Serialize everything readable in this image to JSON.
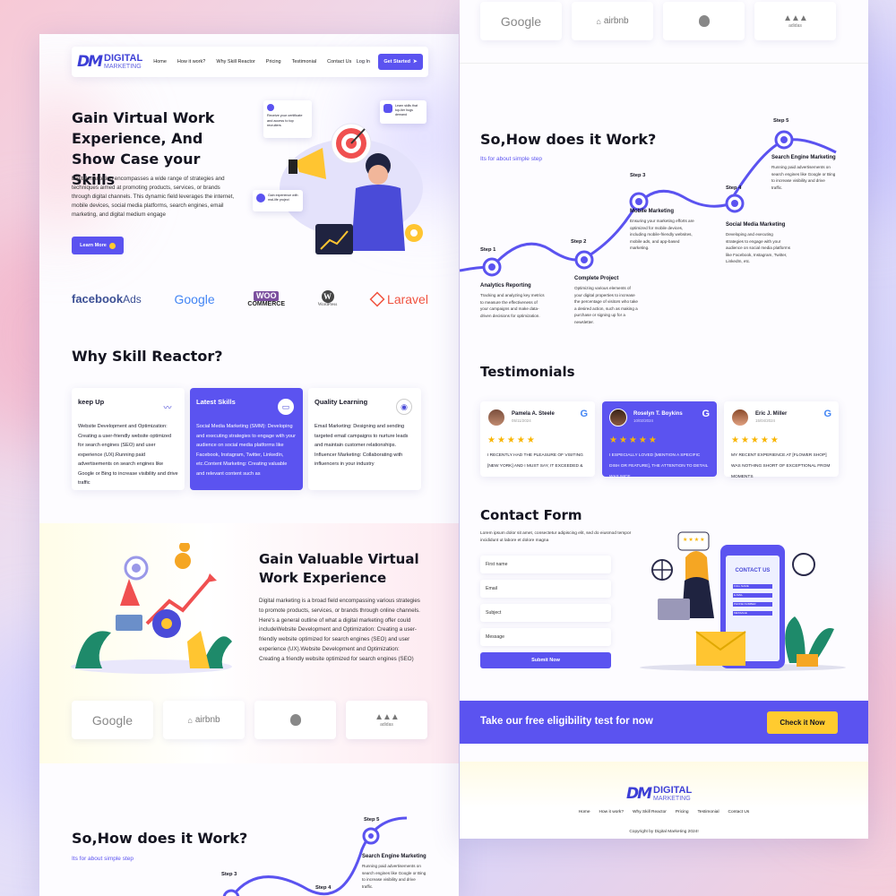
{
  "brand": {
    "logo_mark": "DM",
    "name_line1": "DIGITAL",
    "name_line2": "MARKETING"
  },
  "nav": {
    "links": [
      "Home",
      "How it work?",
      "Why Skill Reactor",
      "Pricing",
      "Testimonial",
      "Contact Us"
    ],
    "login": "Log In",
    "cta": "Get Started"
  },
  "hero": {
    "title": "Gain Virtual Work Experience, And Show Case your Skills",
    "description": "Digital marketing encompasses a wide range of strategies and techniques aimed at promoting products, services, or brands through digital channels. This dynamic field leverages the internet, mobile devices, social media platforms, search engines, email marketing, and digital medium engage",
    "button": "Learn More",
    "bubble1": "Receive your certificate and access to top recruiters",
    "bubble2": "Learn skills that top-tier hugs demand",
    "bubble3": "Gain experience with real-life project"
  },
  "brands": [
    "facebook",
    "Ads",
    "Google",
    "WOO",
    "COMMERCE",
    "WordPress",
    "Laravel"
  ],
  "why": {
    "title": "Why Skill Reactor?",
    "cards": [
      {
        "title": "keep Up",
        "text": "Website Development and Optimization: Creating a user-friendly website optimized for search engines (SEO) and user experience (UX).Running paid advertisements on search engines like Google or Bing to increase visibility and drive traffic"
      },
      {
        "title": "Latest Skills",
        "text": "Social Media Marketing (SMM): Developing and executing strategies to engage with your audience on social media platforms like Facebook, Instagram, Twitter, LinkedIn, etc.Content Marketing: Creating valuable and relevant content such as"
      },
      {
        "title": "Quality Learning",
        "text": "Email Marketing: Designing and sending targeted email campaigns to nurture leads and maintain customer relationships. Influencer Marketing: Collaborating with influencers in your industry"
      }
    ]
  },
  "gain": {
    "title": "Gain Valuable Virtual Work Experience",
    "description": "Digital marketing is a broad field encompassing various strategies to promote products, services, or brands through online channels. Here's a general outline of what a digital marketing offer could includeWebsite Development and Optimization: Creating a user-friendly website optimized for search engines (SEO) and user experience (UX).Website Development and Optimization: Creating a friendly website optimized for search engines (SEO)"
  },
  "partners": [
    "Google",
    "airbnb",
    "",
    "adidas"
  ],
  "how": {
    "title": "So,How does it Work?",
    "subtitle": "Its for about simple step",
    "steps": [
      {
        "label": "Step 1",
        "name": "Analytics Reporting",
        "desc": "Tracking and analyzing key metrics to measure the effectiveness of your campaigns and make data-driven decisions for optimization."
      },
      {
        "label": "Step 2",
        "name": "Complete Project",
        "desc": "Optimizing various elements of your digital properties to increase the percentage of visitors who take a desired action, such as making a purchase or signing up for a newsletter."
      },
      {
        "label": "Step 3",
        "name": "Mobile Marketing",
        "desc": "Ensuring your marketing efforts are optimized for mobile devices, including mobile-friendly websites, mobile ads, and app-based marketing."
      },
      {
        "label": "Step 4",
        "name": "Social Media Marketing",
        "desc": "Developing and executing strategies to engage with your audience on social media platforms like Facebook, Instagram, Twitter, LinkedIn, etc."
      },
      {
        "label": "Step 5",
        "name": "Search Engine Marketing",
        "desc": "Running paid advertisements on search engines like Google or Bing to increase visibility and drive traffic."
      }
    ]
  },
  "testimonials": {
    "title": "Testimonials",
    "items": [
      {
        "name": "Pamela A. Steele",
        "date": "05/11/2024",
        "text": "I RECENTLY HAD THE PLEASURE OF VISITING [NEW YORK] AND I MUST SAY, IT EXCEEDED &"
      },
      {
        "name": "Roselyn T. Boykins",
        "date": "10/02/2024",
        "text": "I ESPECIALLY LOVED [MENTION A SPECIFIC DISH OR FEATURE], THE ATTENTION TO DETAIL WAS NICE"
      },
      {
        "name": "Eric J. Miller",
        "date": "15/04/2024",
        "text": "MY RECENT EXPERIENCE AT [FLOWER SHOP] WAS NOTHING SHORT OF EXCEPTIONAL FROM MOMENTS"
      }
    ],
    "stars": "★★★★★",
    "google": "G"
  },
  "contact": {
    "title": "Contact Form",
    "subtitle": "Lorem ipsum dolor sit amet, consectetur adipiscing elit, sed do eiusmod tempor incididunt ut labore et dolore magna",
    "fields": [
      "First name",
      "Email",
      "Subject",
      "Message"
    ],
    "submit": "Submit Now",
    "illustration_header": "CONTACT US",
    "illustration_fields": [
      "FULL NAME",
      "E-MAIL",
      "PHONE NUMBER",
      "MESSAGE"
    ]
  },
  "cta": {
    "text": "Take our free eligibility test for now",
    "button": "Check it Now"
  },
  "footer": {
    "links": [
      "Home",
      "How it work?",
      "Why Skill Reactor",
      "Pricing",
      "Testimonial",
      "Contact Us"
    ],
    "copyright": "Copyright by Digital Marketing 2024!"
  },
  "colors": {
    "accent": "#5b53f0",
    "yellow": "#ffcb2f",
    "dark": "#141420"
  }
}
